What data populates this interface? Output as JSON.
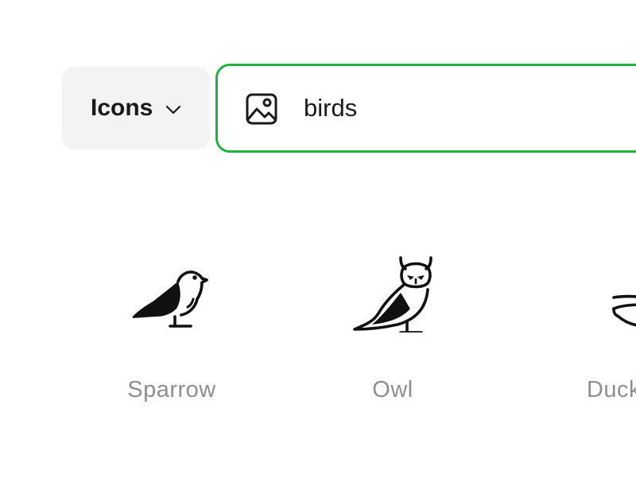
{
  "type_select": {
    "label": "Icons",
    "icon": "chevron-down-icon"
  },
  "search": {
    "icon": "image-icon",
    "value": "birds",
    "accent_color": "#1fb23e"
  },
  "results": [
    {
      "label": "Sparrow",
      "icon": "sparrow-icon"
    },
    {
      "label": "Owl",
      "icon": "owl-icon"
    },
    {
      "label": "Duck",
      "icon": "duck-icon"
    }
  ]
}
